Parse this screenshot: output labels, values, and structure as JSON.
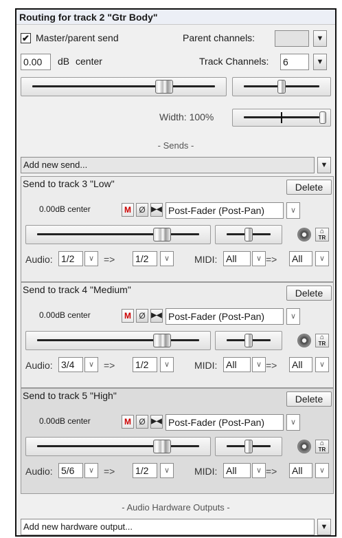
{
  "window": {
    "title": "Routing for track 2 \"Gtr Body\""
  },
  "master": {
    "checkbox_label": "Master/parent send",
    "checked": true,
    "parent_channels_label": "Parent channels:",
    "parent_channels_value": "",
    "volume_value": "0.00",
    "volume_unit": "dB",
    "pan_text": "center",
    "track_channels_label": "Track Channels:",
    "track_channels_value": "6",
    "width_label": "Width: 100%",
    "volume_level": 0.72,
    "pan_level": 0.5,
    "width_level": 1.0
  },
  "sends_header": "- Sends -",
  "add_send": "Add new send...",
  "sends": [
    {
      "title": "Send to track 3 \"Low\"",
      "delete_label": "Delete",
      "vol_text": "0.00dB center",
      "mute_label": "M",
      "phase_label": "Ø",
      "mono_label": "▶◀",
      "mode": "Post-Fader (Post-Pan)",
      "audio_label": "Audio:",
      "audio_src": "1/2",
      "arrow": "=>",
      "audio_dst": "1/2",
      "midi_label": "MIDI:",
      "midi_src": "All",
      "midi_arrow": "=>",
      "midi_dst": "All",
      "tr_label": "TR",
      "volume_level": 0.77,
      "pan_level": 0.5
    },
    {
      "title": "Send to track 4 \"Medium\"",
      "delete_label": "Delete",
      "vol_text": "0.00dB center",
      "mute_label": "M",
      "phase_label": "Ø",
      "mono_label": "▶◀",
      "mode": "Post-Fader (Post-Pan)",
      "audio_label": "Audio:",
      "audio_src": "3/4",
      "arrow": "=>",
      "audio_dst": "1/2",
      "midi_label": "MIDI:",
      "midi_src": "All",
      "midi_arrow": "=>",
      "midi_dst": "All",
      "tr_label": "TR",
      "volume_level": 0.77,
      "pan_level": 0.5
    },
    {
      "title": "Send to track 5 \"High\"",
      "delete_label": "Delete",
      "vol_text": "0.00dB center",
      "mute_label": "M",
      "phase_label": "Ø",
      "mono_label": "▶◀",
      "mode": "Post-Fader (Post-Pan)",
      "audio_label": "Audio:",
      "audio_src": "5/6",
      "arrow": "=>",
      "audio_dst": "1/2",
      "midi_label": "MIDI:",
      "midi_src": "All",
      "midi_arrow": "=>",
      "midi_dst": "All",
      "tr_label": "TR",
      "volume_level": 0.77,
      "pan_level": 0.5
    }
  ],
  "hw_header": "- Audio Hardware Outputs -",
  "add_hw": "Add new hardware output...",
  "dropdown_glyph": "▼",
  "small_dropdown_glyph": "∨",
  "icons": {
    "check": "check-icon",
    "dropdown": "chevron-down-icon",
    "mute": "mute-icon",
    "phase": "phase-invert-icon",
    "mono": "mono-icon",
    "pan_knob": "pan-law-knob-icon",
    "tr": "trim-icon"
  },
  "colors": {
    "mute_red": "#cc0000",
    "window_bg": "#f0f0f0",
    "active_send_bg": "#dcdcdc"
  }
}
